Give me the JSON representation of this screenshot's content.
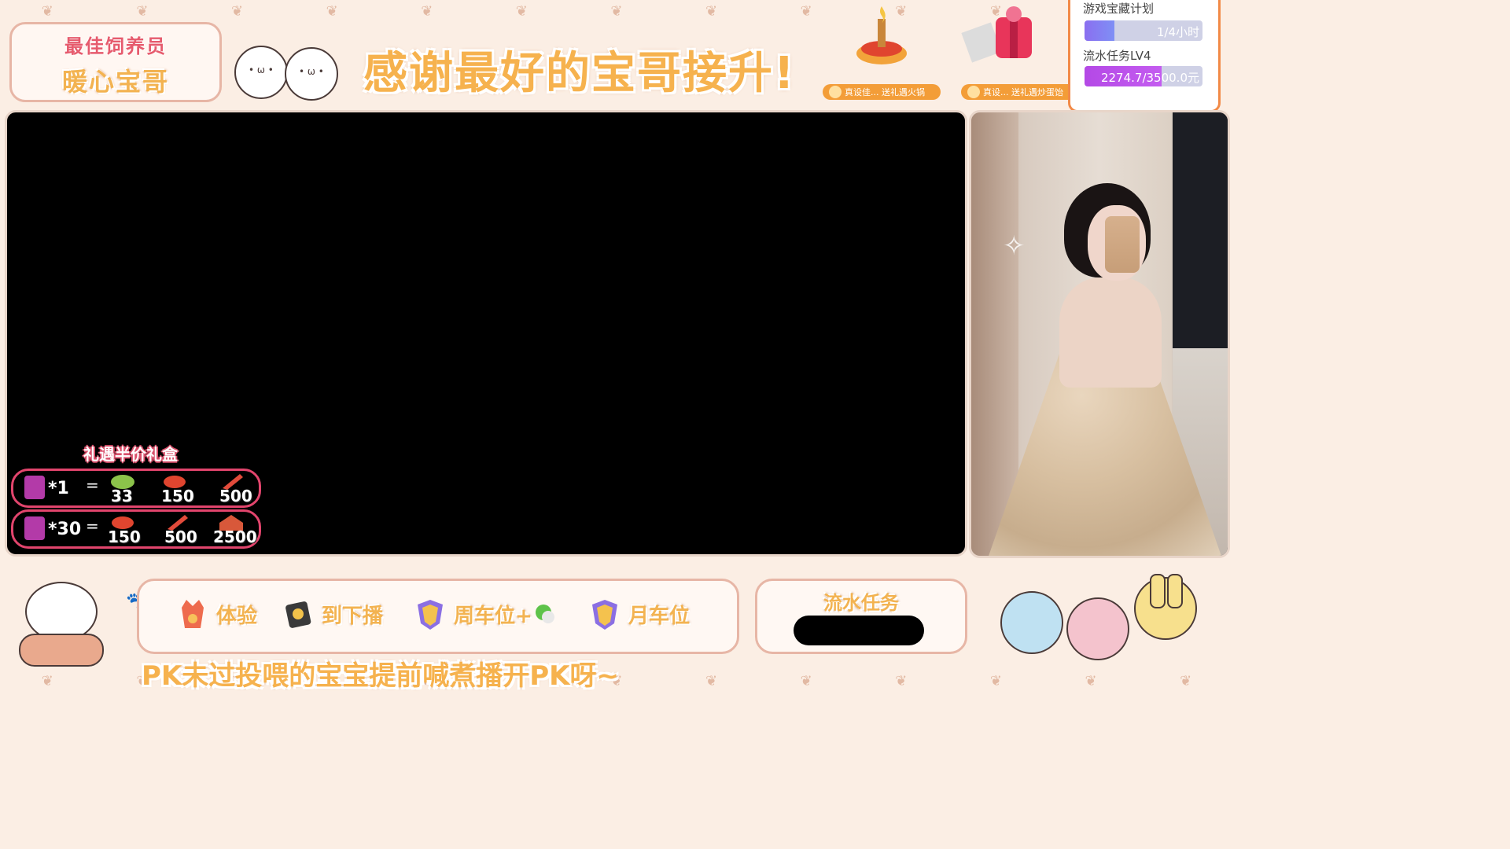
{
  "header": {
    "role_title": "最佳饲养员",
    "role_name": "暖心宝哥",
    "headline": "感谢最好的宝哥接升!"
  },
  "gift_tags": [
    {
      "text": "真设佳...  送礼遇火锅"
    },
    {
      "text": "真设...  送礼遇炒蛋饴"
    }
  ],
  "tasks": {
    "treasure_label": "游戏宝藏计划",
    "treasure_progress": "1/4小时",
    "treasure_fraction": 0.25,
    "flow_label": "流水任务LV4",
    "flow_progress": "2274.7/3500.0元",
    "flow_fraction": 0.65
  },
  "offer": {
    "title": "礼遇半价礼盒",
    "rows": [
      {
        "qty": "*1",
        "eq": "=",
        "values": [
          "33",
          "150",
          "500"
        ]
      },
      {
        "qty": "*30",
        "eq": "=",
        "values": [
          "150",
          "500",
          "2500"
        ]
      }
    ]
  },
  "bottom_bar": {
    "items": [
      {
        "label": "体验"
      },
      {
        "label": "到下播"
      },
      {
        "label": "周车位+"
      },
      {
        "label": "月车位"
      }
    ]
  },
  "flow_box": {
    "title": "流水任务"
  },
  "ticker": "PK未过投喂的宝宝提前喊煮播开PK呀~",
  "colors": {
    "accent_orange": "#f6b24e",
    "accent_pink": "#e65b6d",
    "frame": "#e7b6a6",
    "task_border": "#f28a47"
  }
}
